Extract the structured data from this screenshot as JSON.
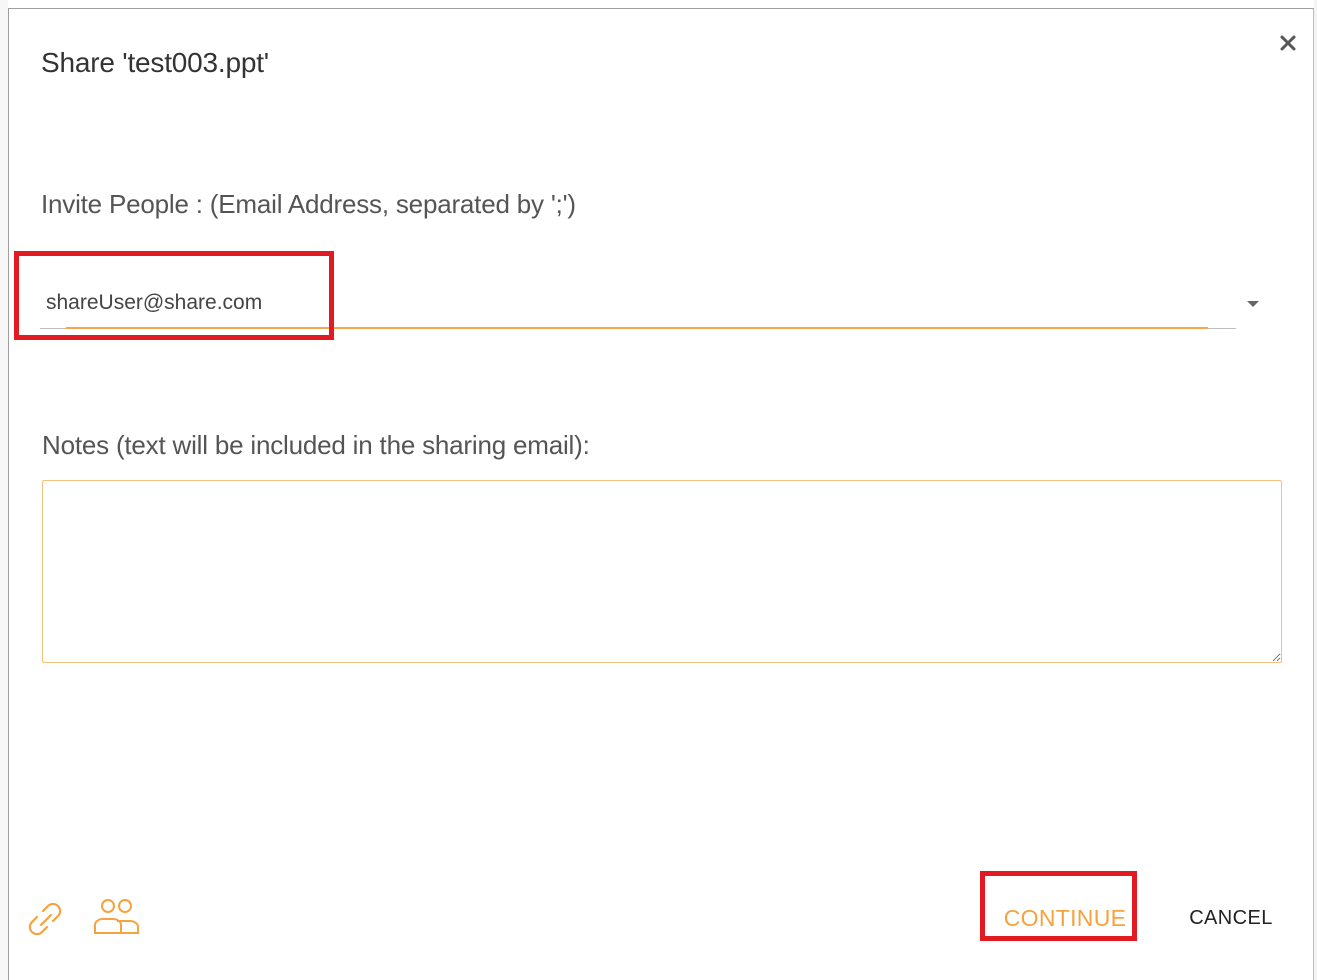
{
  "dialog": {
    "title": "Share 'test003.ppt'",
    "close_icon": "close-icon"
  },
  "invite": {
    "label": "Invite People : (Email Address, separated by ';')",
    "value": "shareUser@share.com",
    "dropdown_icon": "chevron-down-icon"
  },
  "notes": {
    "label": "Notes (text will be included in the sharing email):",
    "value": ""
  },
  "footer": {
    "link_icon": "link-icon",
    "people_icon": "people-icon",
    "continue_label": "CONTINUE",
    "cancel_label": "CANCEL"
  },
  "colors": {
    "accent": "#f6a23e",
    "highlight": "#e21b23"
  }
}
